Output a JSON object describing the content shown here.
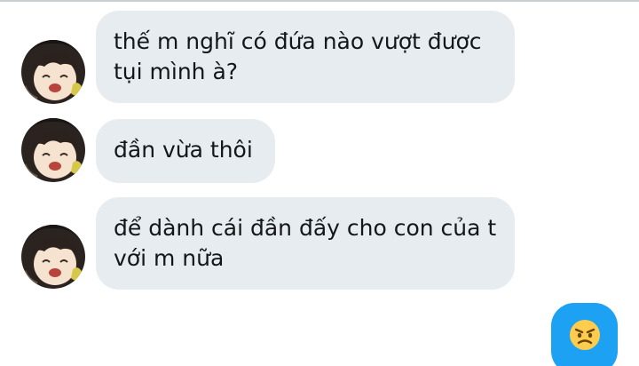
{
  "conversation": {
    "messages": [
      {
        "side": "received",
        "lines": [
          "thế m nghĩ có đứa nào vượt được",
          "tụi mình à?"
        ]
      },
      {
        "side": "received",
        "lines": [
          "đần vừa thôi"
        ]
      },
      {
        "side": "received",
        "lines": [
          "để dành cái đần đấy cho con của t",
          "với m nữa"
        ]
      },
      {
        "side": "sent",
        "emoji": "angry-face-icon"
      }
    ]
  },
  "colors": {
    "received_bubble": "#e6ecf0",
    "sent_bubble": "#1da1f2",
    "text": "#14171a"
  }
}
